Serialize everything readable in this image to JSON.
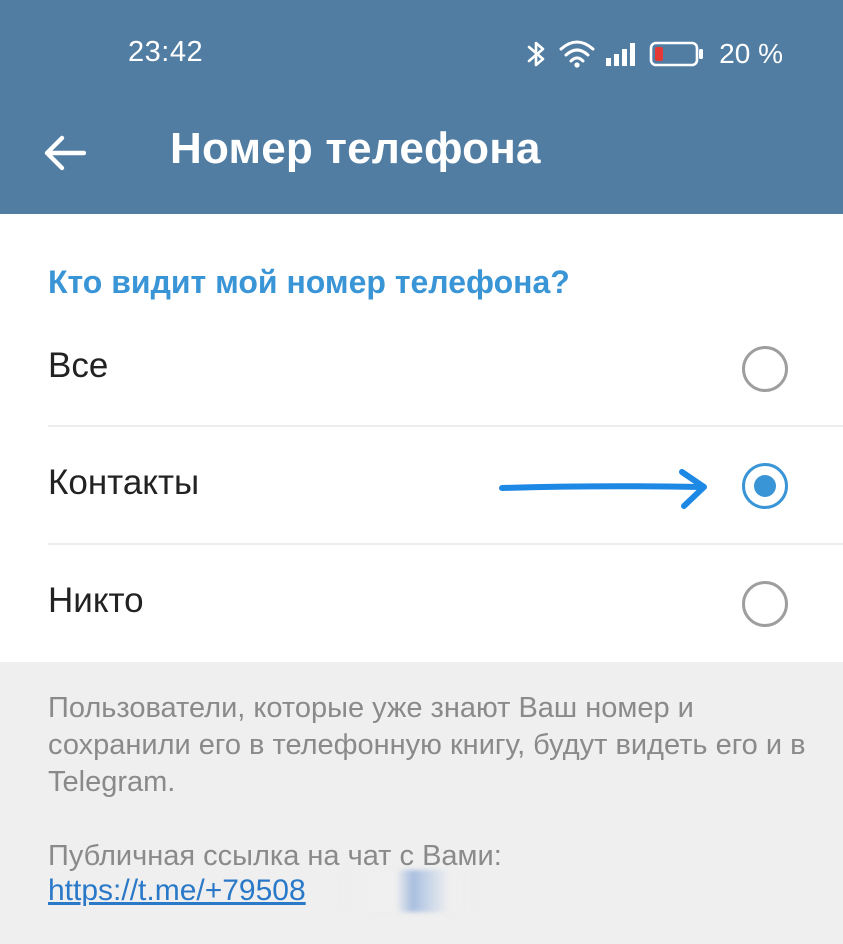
{
  "status_bar": {
    "time": "23:42",
    "battery_percent": "20 %",
    "icons": [
      "bluetooth-icon",
      "wifi-icon",
      "signal-icon",
      "battery-low-icon"
    ]
  },
  "header": {
    "title": "Номер телефона",
    "back_icon": "arrow-left-icon",
    "background_color": "#517da2"
  },
  "privacy": {
    "section_title": "Кто видит мой номер телефона?",
    "options": [
      {
        "label": "Все",
        "selected": false
      },
      {
        "label": "Контакты",
        "selected": true
      },
      {
        "label": "Никто",
        "selected": false
      }
    ],
    "accent_color": "#3a95d6"
  },
  "info": {
    "description": "Пользователи, которые уже знают Ваш номер и сохранили его в телефонную книгу, будут видеть его и в Telegram.",
    "public_link_label": "Публичная ссылка на чат с Вами:",
    "public_link_text": "https://t.me/+79508"
  }
}
